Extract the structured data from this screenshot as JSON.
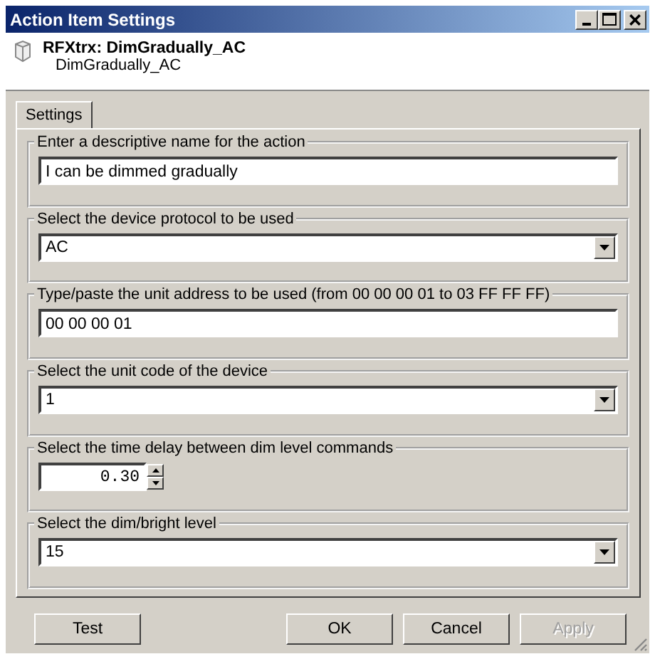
{
  "window": {
    "title": "Action Item Settings"
  },
  "header": {
    "title": "RFXtrx: DimGradually_AC",
    "subtitle": "DimGradually_AC"
  },
  "tabs": [
    {
      "label": "Settings",
      "selected": true
    }
  ],
  "groups": [
    {
      "label": "Enter a descriptive name for the action",
      "kind": "text",
      "value": "I can be dimmed gradually"
    },
    {
      "label": "Select the device protocol to be used",
      "kind": "select",
      "value": "AC"
    },
    {
      "label": "Type/paste the unit address to be used (from 00 00 00 01 to 03 FF FF FF)",
      "kind": "text",
      "value": "00 00 00 01"
    },
    {
      "label": "Select the unit code of the device",
      "kind": "select",
      "value": "1"
    },
    {
      "label": "Select the time delay between dim level commands",
      "kind": "spin",
      "value": "0.30"
    },
    {
      "label": "Select the dim/bright level",
      "kind": "select",
      "value": "15"
    }
  ],
  "buttons": [
    {
      "label": "Test",
      "disabled": false
    },
    {
      "label": "OK",
      "disabled": false
    },
    {
      "label": "Cancel",
      "disabled": false
    },
    {
      "label": "Apply",
      "disabled": true
    }
  ]
}
